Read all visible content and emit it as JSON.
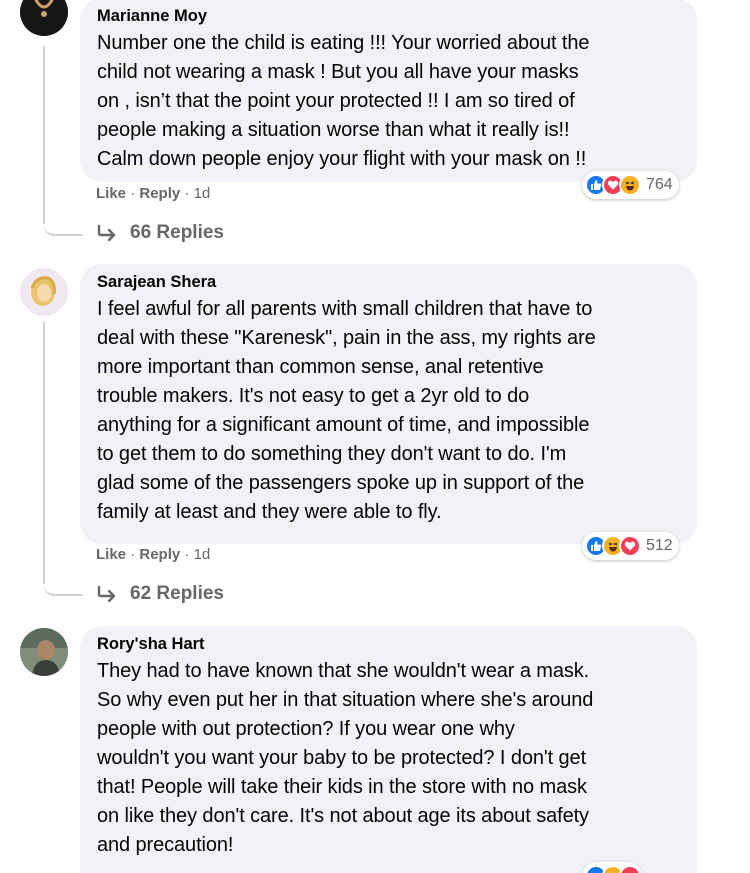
{
  "comments": [
    {
      "author": "Marianne Moy",
      "lines": [
        "Number one the child is eating !!! Your worried about the",
        "child not wearing a mask ! But you all have your masks",
        "on , isn’t that the point your protected !! I am so tired of",
        "people making a situation worse than what it really is!!",
        "Calm down people enjoy your flight with your mask on !!"
      ],
      "like_label": "Like",
      "reply_label": "Reply",
      "time": "1d",
      "reaction_icons": [
        "like-reaction",
        "love-reaction",
        "haha-reaction"
      ],
      "reaction_count": "764",
      "replies_label": "66 Replies"
    },
    {
      "author": "Sarajean Shera",
      "lines": [
        "I feel awful for all parents with small children that have to",
        "deal with these \"Karenesk\", pain in the ass, my rights are",
        "more important than common sense, anal retentive",
        "trouble makers. It's not easy to get a 2yr old to do",
        "anything for a significant amount of time, and impossible",
        "to get them to do something they don't want to do. I'm",
        "glad some of the passengers spoke up in support of the",
        "family at least and they were able to fly."
      ],
      "like_label": "Like",
      "reply_label": "Reply",
      "time": "1d",
      "reaction_icons": [
        "like-reaction",
        "haha-reaction",
        "love-reaction"
      ],
      "reaction_count": "512",
      "replies_label": "62 Replies"
    },
    {
      "author": "Rory'sha Hart",
      "lines": [
        "They had to have known that she wouldn't wear a mask.",
        "So why even put her in that situation where she's around",
        "people with out protection? If you wear one why",
        "wouldn't you want your baby to be protected? I don't get",
        "that! People will take their kids in the store with no mask",
        "on like they don't care. It's not about age its about safety",
        "and precaution!"
      ]
    }
  ],
  "colors": {
    "bubble": "#f0f2f5",
    "secondary_text": "#65676b",
    "like_blue": "#1877f2",
    "love_red": "#f33e58",
    "haha_yellow": "#f7b125"
  }
}
